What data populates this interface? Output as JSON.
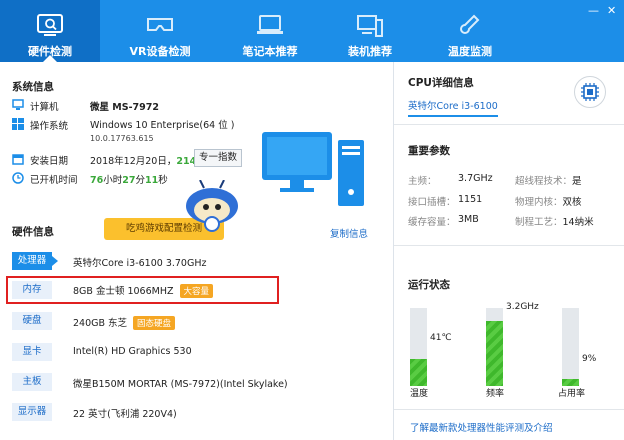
{
  "window": {
    "minimize_label": "—",
    "close_label": "✕"
  },
  "nav": {
    "tabs": [
      {
        "label": "硬件检测",
        "icon": "monitor-icon"
      },
      {
        "label": "VR设备检测",
        "icon": "vr-headset-icon"
      },
      {
        "label": "笔记本推荐",
        "icon": "laptop-icon"
      },
      {
        "label": "装机推荐",
        "icon": "pc-build-icon"
      },
      {
        "label": "温度监测",
        "icon": "thermometer-icon"
      }
    ]
  },
  "system": {
    "title": "系统信息",
    "computer_label": "计算机",
    "computer_value": "微星 MS-7972",
    "os_label": "操作系统",
    "os_value": "Windows 10 Enterprise(64 位 )",
    "os_build": "10.0.17763.615",
    "install_label": "安装日期",
    "install_date": "2018年12月20日，",
    "install_days": "214",
    "install_days_unit": "天",
    "index_button": "专一指数",
    "uptime_label": "已开机时间",
    "uptime_h": "76",
    "uptime_h_unit": "小时",
    "uptime_m": "27",
    "uptime_m_unit": "分",
    "uptime_s": "11",
    "uptime_s_unit": "秒"
  },
  "hardware": {
    "title": "硬件信息",
    "game_button": "吃鸡游戏配置检测",
    "copy_link": "复制信息",
    "items": [
      {
        "label": "处理器",
        "value": "英特尔Core i3-6100 3.70GHz",
        "tag": ""
      },
      {
        "label": "内存",
        "value": "8GB 金士顿 1066MHZ",
        "tag": "大容量"
      },
      {
        "label": "硬盘",
        "value": "240GB 东芝",
        "tag": "固态硬盘"
      },
      {
        "label": "显卡",
        "value": "Intel(R) HD Graphics 530",
        "tag": ""
      },
      {
        "label": "主板",
        "value": "微星B150M MORTAR (MS-7972)(Intel Skylake)",
        "tag": ""
      },
      {
        "label": "显示器",
        "value": "22 英寸(飞利浦 220V4)",
        "tag": ""
      }
    ]
  },
  "cpu": {
    "title": "CPU详细信息",
    "name": "英特尔Core i3-6100"
  },
  "params": {
    "title": "重要参数",
    "freq_label": "主频：",
    "freq_value": "3.7GHz",
    "ht_label": "超线程技术：",
    "ht_value": "是",
    "socket_label": "接口插槽：",
    "socket_value": "1151",
    "cores_label": "物理内核：",
    "cores_value": "双核",
    "cache_label": "缓存容量：",
    "cache_value": "3MB",
    "process_label": "制程工艺：",
    "process_value": "14纳米"
  },
  "status": {
    "title": "运行状态",
    "temp_label": "温度",
    "temp_value": "41℃",
    "temp_level": 0.35,
    "freq_label": "频率",
    "freq_value": "3.2GHz",
    "freq_level": 0.83,
    "usage_label": "占用率",
    "usage_value": "9%",
    "usage_level": 0.09
  },
  "footer_link": "了解最新款处理器性能评测及介绍",
  "colors": {
    "brand": "#1c8ee8",
    "active_tab": "#0f6fc6",
    "accent_green": "#59cc43",
    "tag_orange": "#f5a623",
    "highlight_red": "#e02020"
  }
}
